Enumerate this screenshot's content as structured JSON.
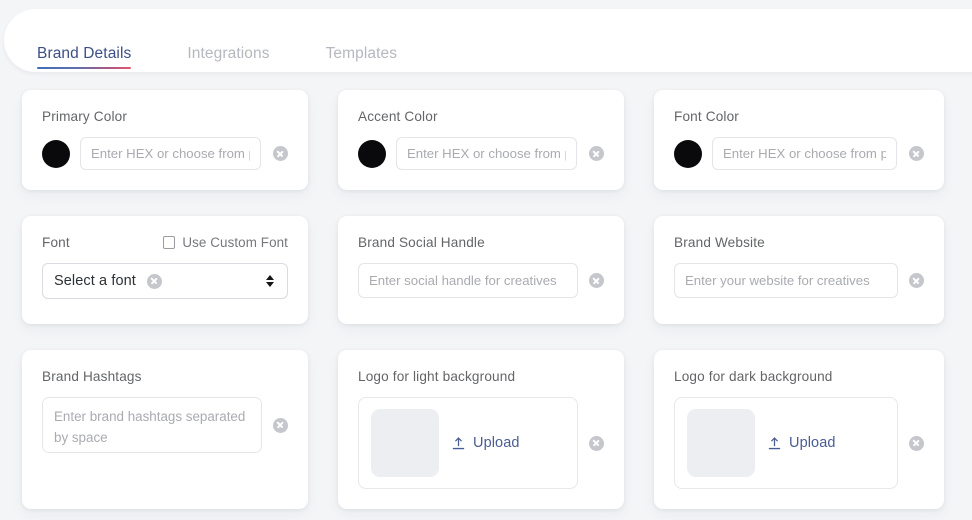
{
  "header": {
    "tabs": [
      {
        "label": "Brand Details",
        "active": true
      },
      {
        "label": "Integrations",
        "active": false
      },
      {
        "label": "Templates",
        "active": false
      }
    ],
    "active_tab_gradient_from": "#3f6fb5",
    "active_tab_gradient_to": "#e2586c"
  },
  "cards": {
    "primary_color": {
      "label": "Primary Color",
      "swatch_color": "#0a0a0c",
      "input_value": "",
      "input_placeholder": "Enter HEX or choose from palette",
      "clear_icon": "clear-circle-icon"
    },
    "accent_color": {
      "label": "Accent Color",
      "swatch_color": "#0a0a0c",
      "input_value": "",
      "input_placeholder": "Enter HEX or choose from palette",
      "clear_icon": "clear-circle-icon"
    },
    "font_color": {
      "label": "Font Color",
      "swatch_color": "#0a0a0c",
      "input_value": "",
      "input_placeholder": "Enter HEX or choose from palette",
      "clear_icon": "clear-circle-icon"
    },
    "font": {
      "label": "Font",
      "custom_font_checkbox_label": "Use Custom Font",
      "custom_font_checked": false,
      "select_value": "Select a font",
      "clear_icon": "clear-circle-icon",
      "arrows_icon": "select-updown-arrows-icon"
    },
    "brand_social_handle": {
      "label": "Brand Social Handle",
      "input_value": "",
      "input_placeholder": "Enter social handle for creatives",
      "clear_icon": "clear-circle-icon"
    },
    "brand_website": {
      "label": "Brand Website",
      "input_value": "",
      "input_placeholder": "Enter your website for creatives",
      "clear_icon": "clear-circle-icon"
    },
    "brand_hashtags": {
      "label": "Brand Hashtags",
      "textarea_value": "",
      "textarea_placeholder": "Enter brand hashtags separated by space",
      "clear_icon": "clear-circle-icon"
    },
    "logo_light": {
      "label": "Logo for light background",
      "preview_placeholder_color": "#eceef2",
      "upload_label": "Upload",
      "upload_icon": "upload-icon",
      "clear_icon": "clear-circle-icon"
    },
    "logo_dark": {
      "label": "Logo for dark background",
      "preview_placeholder_color": "#eceef2",
      "upload_label": "Upload",
      "upload_icon": "upload-icon",
      "clear_icon": "clear-circle-icon"
    }
  }
}
